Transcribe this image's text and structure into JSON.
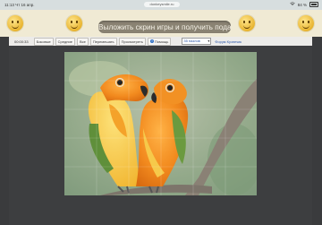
{
  "status_bar": {
    "time": "11:13",
    "date": "Чт 16 апр.",
    "url": "donkeysmile.ru",
    "signal": "••• ",
    "battery_text": "84 %"
  },
  "header": {
    "banner_text": "Выложить скрин игры и получить подарок"
  },
  "toolbar": {
    "timer": "00:00:33",
    "buttons": [
      "Боковые",
      "Средние",
      "Все",
      "Перемешать",
      "Просмотреть"
    ],
    "help_label": "Помощь",
    "pieces_select": {
      "selected": "35 пазлов"
    },
    "forum_link": "Форум Кузнечик"
  },
  "puzzle": {
    "image_subject": "two orange parrots on a branch",
    "colors": {
      "parrot_orange": "#f08a1c",
      "parrot_yellow": "#f6c53a",
      "background_green": "#98ad8c",
      "branch": "#8b7f72"
    }
  }
}
